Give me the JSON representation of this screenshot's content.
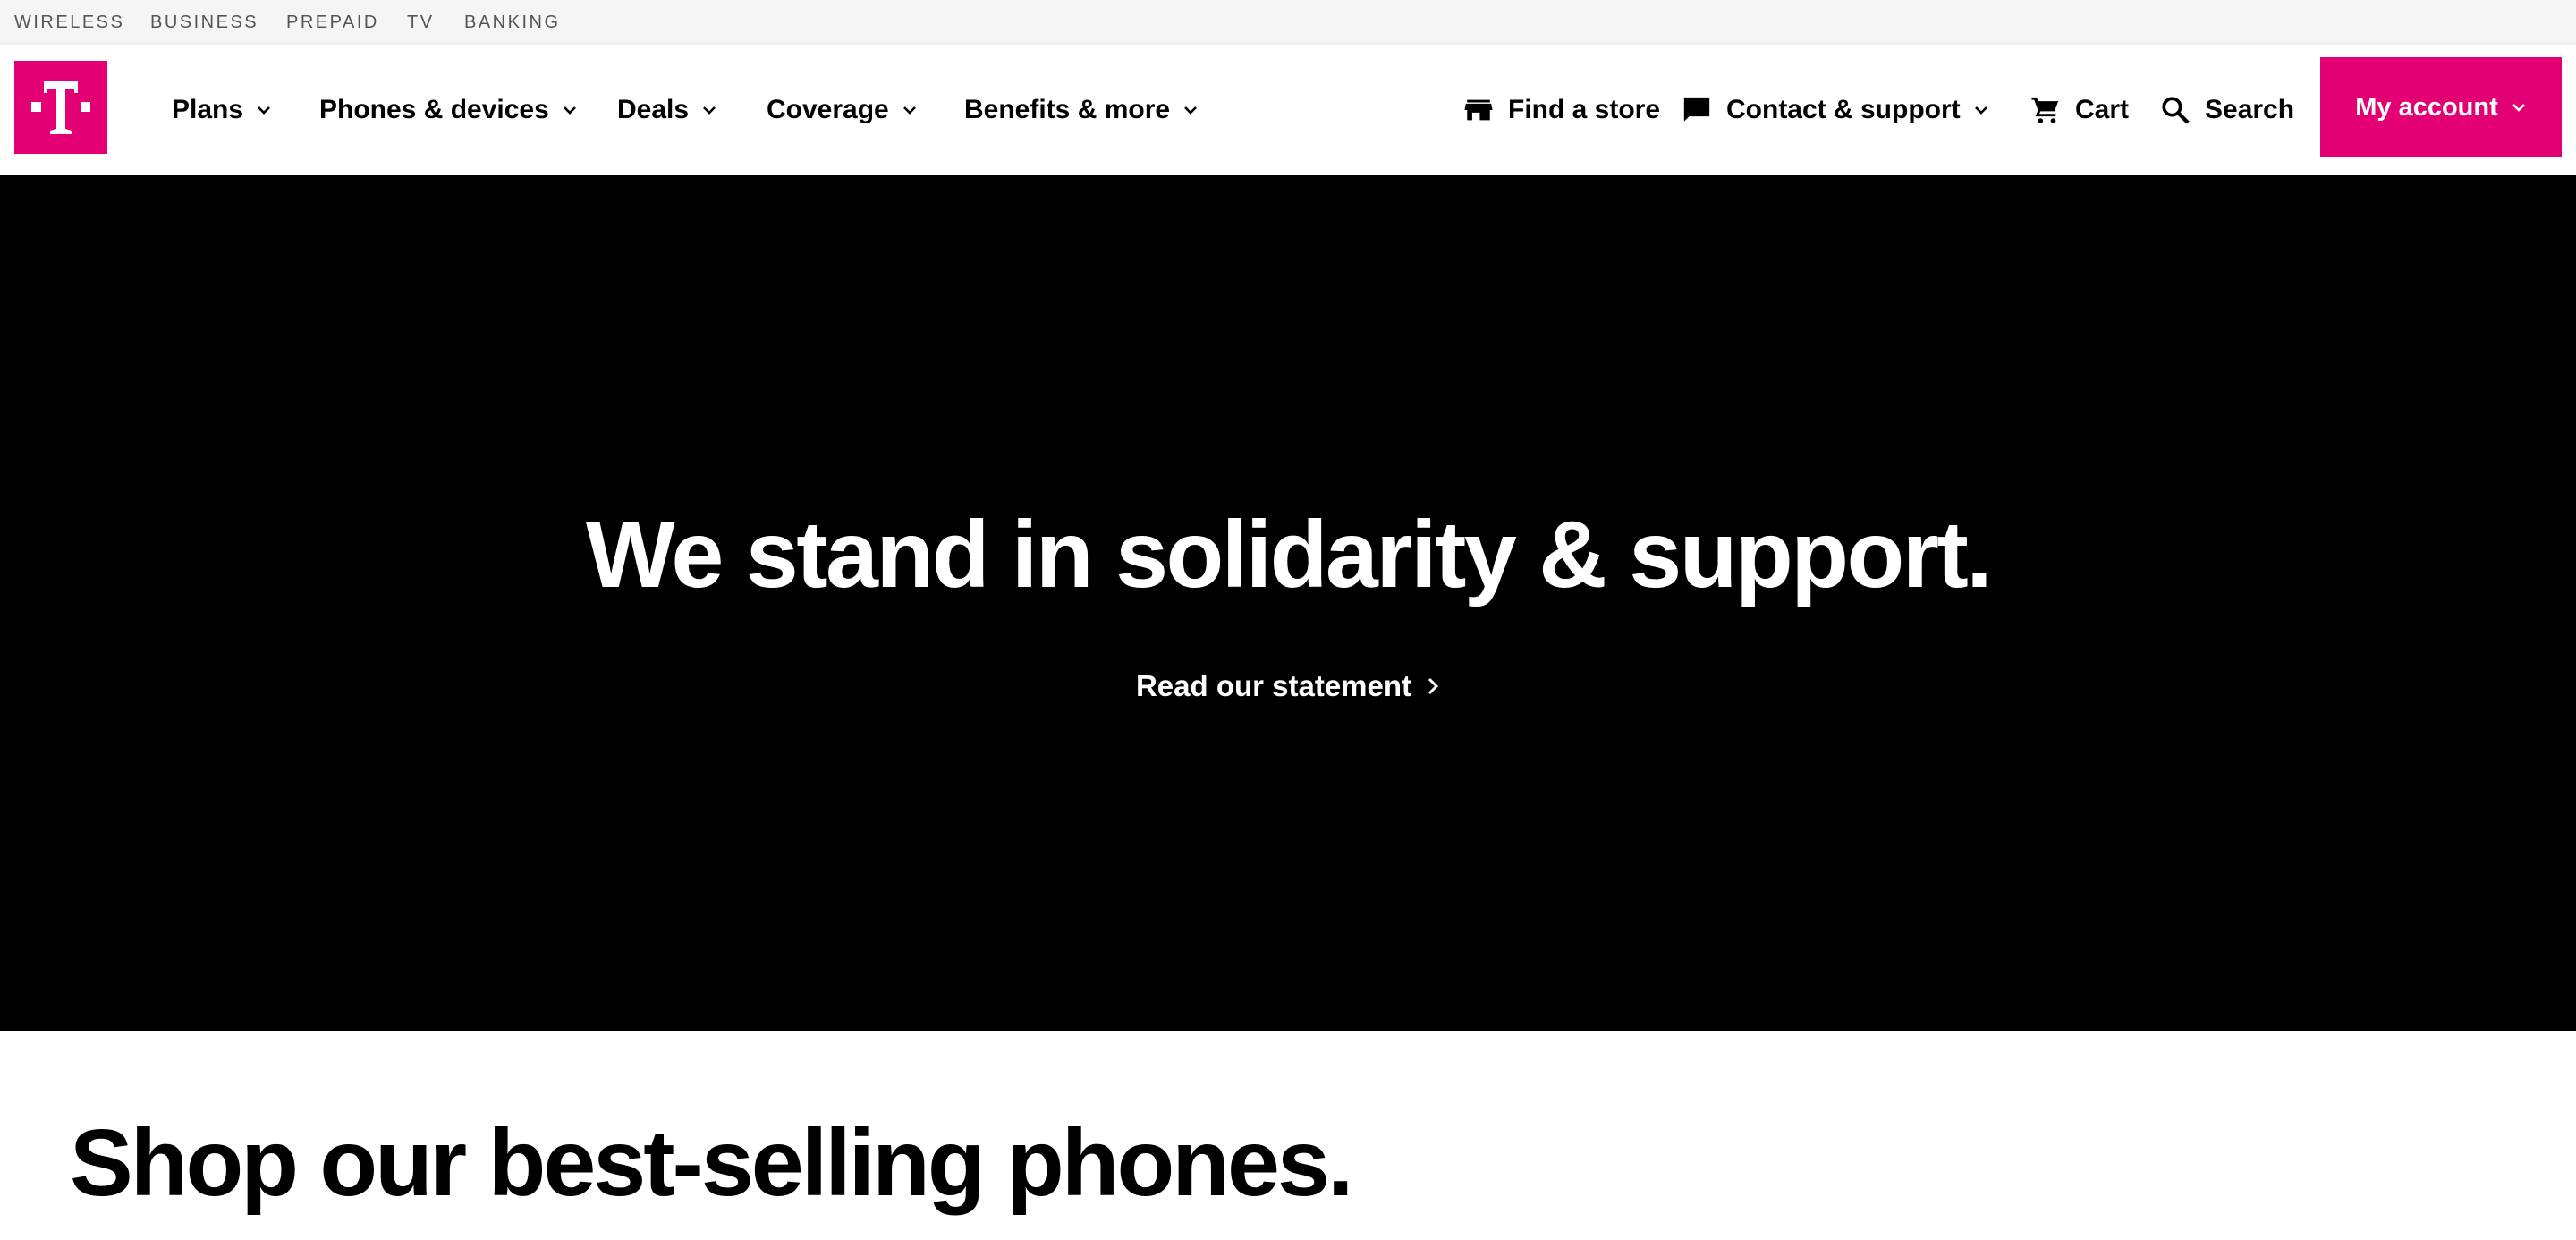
{
  "utility_nav": {
    "items": [
      {
        "label": "WIRELESS"
      },
      {
        "label": "BUSINESS"
      },
      {
        "label": "PREPAID"
      },
      {
        "label": "TV"
      },
      {
        "label": "BANKING"
      }
    ]
  },
  "brand": {
    "logo_letter": "T",
    "accent": "#e20074"
  },
  "main_nav": {
    "items": [
      {
        "label": "Plans"
      },
      {
        "label": "Phones & devices"
      },
      {
        "label": "Deals"
      },
      {
        "label": "Coverage"
      },
      {
        "label": "Benefits & more"
      }
    ]
  },
  "utilities": {
    "find_store": {
      "label": "Find a store",
      "icon": "store-icon"
    },
    "contact": {
      "label": "Contact & support",
      "icon": "chat-icon"
    },
    "cart": {
      "label": "Cart",
      "icon": "cart-icon"
    },
    "search": {
      "label": "Search",
      "icon": "search-icon"
    }
  },
  "account": {
    "label": "My account"
  },
  "hero": {
    "title": "We stand in solidarity & support.",
    "link_label": "Read our statement",
    "background": "#000000"
  },
  "shop": {
    "title": "Shop our best-selling phones."
  }
}
